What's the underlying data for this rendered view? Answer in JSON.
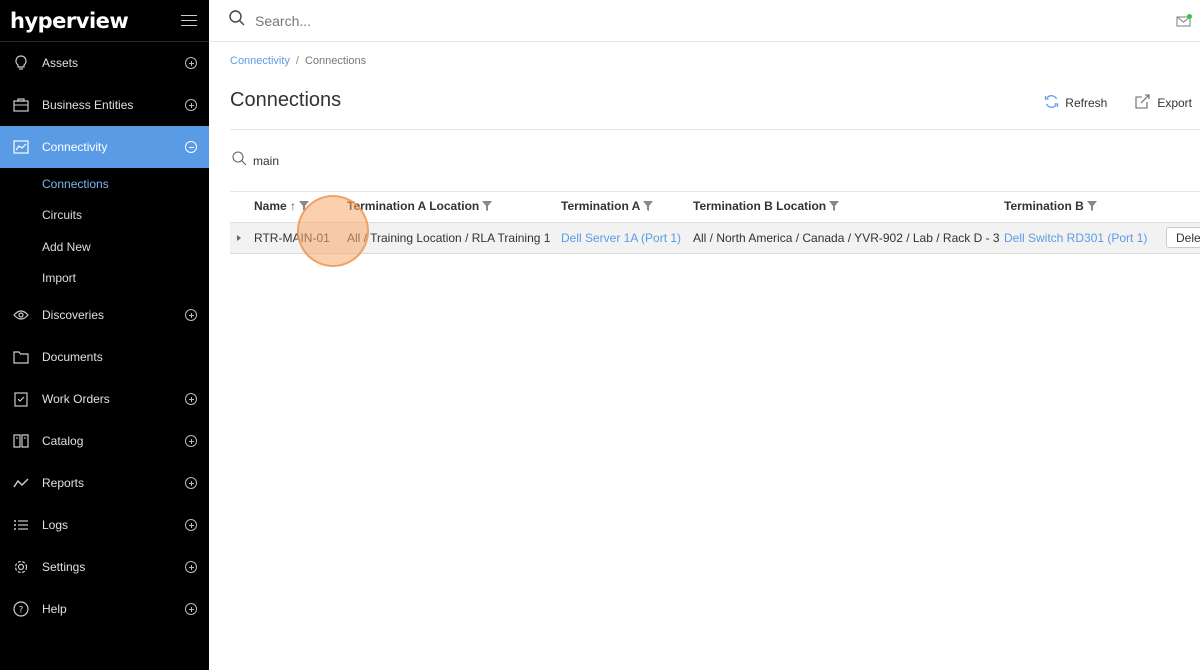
{
  "app": {
    "logo": "hyperview"
  },
  "sidebar": {
    "items": [
      {
        "label": "Assets",
        "icon": "bulb-icon"
      },
      {
        "label": "Business Entities",
        "icon": "briefcase-icon"
      },
      {
        "label": "Connectivity",
        "icon": "network-icon"
      },
      {
        "label": "Discoveries",
        "icon": "eye-icon"
      },
      {
        "label": "Documents",
        "icon": "folder-icon"
      },
      {
        "label": "Work Orders",
        "icon": "clipboard-icon"
      },
      {
        "label": "Catalog",
        "icon": "book-icon"
      },
      {
        "label": "Reports",
        "icon": "chart-line-icon"
      },
      {
        "label": "Logs",
        "icon": "list-icon"
      },
      {
        "label": "Settings",
        "icon": "gear-icon"
      },
      {
        "label": "Help",
        "icon": "question-icon"
      }
    ],
    "sub_items": [
      "Connections",
      "Circuits",
      "Add New",
      "Import"
    ]
  },
  "topbar": {
    "search_placeholder": "Search..."
  },
  "breadcrumb": {
    "parent": "Connectivity",
    "separator": "/",
    "current": "Connections"
  },
  "page": {
    "title": "Connections",
    "refresh_label": "Refresh",
    "export_label": "Export"
  },
  "filter": {
    "value": "main"
  },
  "table": {
    "headers": [
      "Name",
      "Termination A Location",
      "Termination A",
      "Termination B Location",
      "Termination B"
    ],
    "sort_indicator": "↑",
    "rows": [
      {
        "name": "RTR-MAIN-01",
        "term_a_location": "All / Training Location / RLA Training 1",
        "term_a": "Dell Server 1A (Port 1)",
        "term_b_location": "All / North America / Canada / YVR-902 / Lab / Rack D - 3",
        "term_b": "Dell Switch RD301 (Port 1)",
        "action": "Dele"
      }
    ]
  },
  "colors": {
    "accent": "#5a9be6",
    "sidebar_bg": "#000000",
    "notification": "#2ecc40"
  }
}
